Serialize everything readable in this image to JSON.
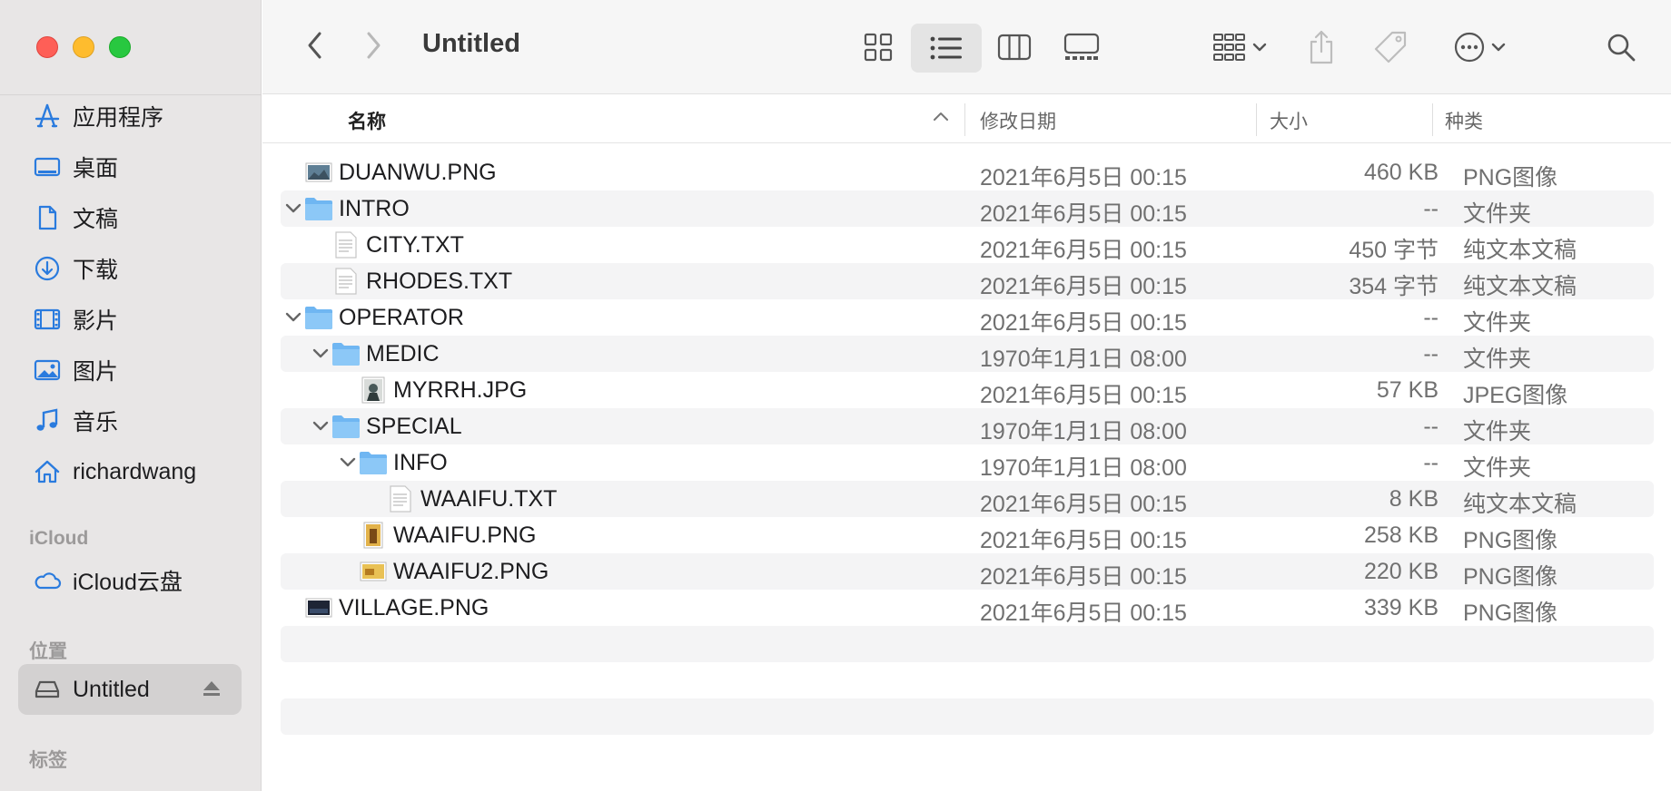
{
  "window": {
    "title": "Untitled"
  },
  "sidebar": {
    "favorites": [
      {
        "label": "应用程序",
        "icon": "applications-icon"
      },
      {
        "label": "桌面",
        "icon": "desktop-icon"
      },
      {
        "label": "文稿",
        "icon": "document-icon"
      },
      {
        "label": "下载",
        "icon": "download-icon"
      },
      {
        "label": "影片",
        "icon": "film-icon"
      },
      {
        "label": "图片",
        "icon": "photo-icon"
      },
      {
        "label": "音乐",
        "icon": "music-icon"
      },
      {
        "label": "richardwang",
        "icon": "home-icon"
      }
    ],
    "icloud_section": "iCloud",
    "icloud_items": [
      {
        "label": "iCloud云盘",
        "icon": "cloud-icon"
      }
    ],
    "locations_section": "位置",
    "locations": [
      {
        "label": "Untitled",
        "icon": "drive-icon",
        "selected": true
      }
    ],
    "tags_section": "标签"
  },
  "columns": {
    "name": "名称",
    "date": "修改日期",
    "size": "大小",
    "kind": "种类"
  },
  "files": [
    {
      "name": "DUANWU.PNG",
      "date": "2021年6月5日 00:15",
      "size": "460 KB",
      "kind": "PNG图像",
      "level": 0,
      "type": "image-landscape",
      "expanded": null
    },
    {
      "name": "INTRO",
      "date": "2021年6月5日 00:15",
      "size": "--",
      "kind": "文件夹",
      "level": 0,
      "type": "folder",
      "expanded": true
    },
    {
      "name": "CITY.TXT",
      "date": "2021年6月5日 00:15",
      "size": "450 字节",
      "kind": "纯文本文稿",
      "level": 1,
      "type": "text",
      "expanded": null
    },
    {
      "name": "RHODES.TXT",
      "date": "2021年6月5日 00:15",
      "size": "354 字节",
      "kind": "纯文本文稿",
      "level": 1,
      "type": "text",
      "expanded": null
    },
    {
      "name": "OPERATOR",
      "date": "2021年6月5日 00:15",
      "size": "--",
      "kind": "文件夹",
      "level": 0,
      "type": "folder",
      "expanded": true
    },
    {
      "name": "MEDIC",
      "date": "1970年1月1日 08:00",
      "size": "--",
      "kind": "文件夹",
      "level": 1,
      "type": "folder",
      "expanded": true
    },
    {
      "name": "MYRRH.JPG",
      "date": "2021年6月5日 00:15",
      "size": "57 KB",
      "kind": "JPEG图像",
      "level": 2,
      "type": "image-portrait",
      "expanded": null
    },
    {
      "name": "SPECIAL",
      "date": "1970年1月1日 08:00",
      "size": "--",
      "kind": "文件夹",
      "level": 1,
      "type": "folder",
      "expanded": true
    },
    {
      "name": "INFO",
      "date": "1970年1月1日 08:00",
      "size": "--",
      "kind": "文件夹",
      "level": 2,
      "type": "folder",
      "expanded": true
    },
    {
      "name": "WAAIFU.TXT",
      "date": "2021年6月5日 00:15",
      "size": "8 KB",
      "kind": "纯文本文稿",
      "level": 3,
      "type": "text",
      "expanded": null
    },
    {
      "name": "WAAIFU.PNG",
      "date": "2021年6月5日 00:15",
      "size": "258 KB",
      "kind": "PNG图像",
      "level": 2,
      "type": "image-tall",
      "expanded": null
    },
    {
      "name": "WAAIFU2.PNG",
      "date": "2021年6月5日 00:15",
      "size": "220 KB",
      "kind": "PNG图像",
      "level": 2,
      "type": "image-gold",
      "expanded": null
    },
    {
      "name": "VILLAGE.PNG",
      "date": "2021年6月5日 00:15",
      "size": "339 KB",
      "kind": "PNG图像",
      "level": 0,
      "type": "image-dark",
      "expanded": null
    }
  ],
  "colors": {
    "accent": "#2a7bde",
    "folder": "#6fb6f2",
    "selected_bg": "#d3d1d1"
  }
}
